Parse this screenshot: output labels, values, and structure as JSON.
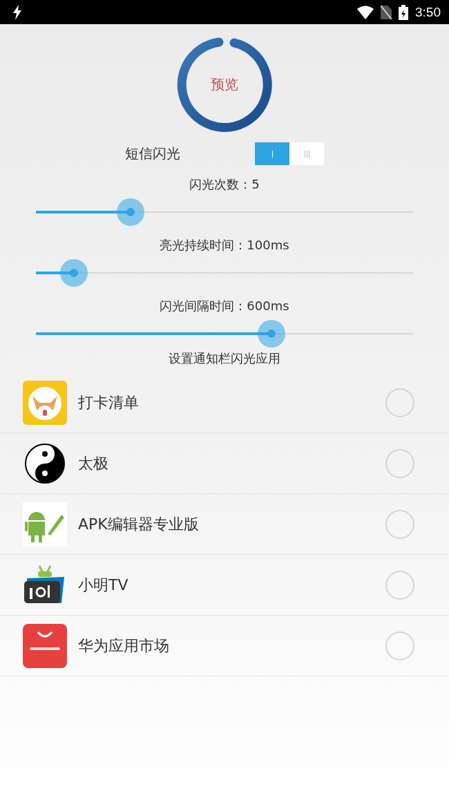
{
  "status_bar": {
    "time": "3:50"
  },
  "preview": {
    "label": "预览"
  },
  "sms_flash": {
    "label": "短信闪光",
    "on": true
  },
  "sliders": [
    {
      "label": "闪光次数：5",
      "level": 0.25
    },
    {
      "label": "亮光持续时间：100ms",
      "level": 0.1
    },
    {
      "label": "闪光间隔时间：600ms",
      "level": 0.625
    }
  ],
  "apps_heading": "设置通知栏闪光应用",
  "apps": [
    {
      "name": "打卡清单",
      "checked": false
    },
    {
      "name": "太极",
      "checked": false
    },
    {
      "name": "APK编辑器专业版",
      "checked": false
    },
    {
      "name": "小明TV",
      "checked": false
    },
    {
      "name": "华为应用市场",
      "checked": false
    }
  ]
}
